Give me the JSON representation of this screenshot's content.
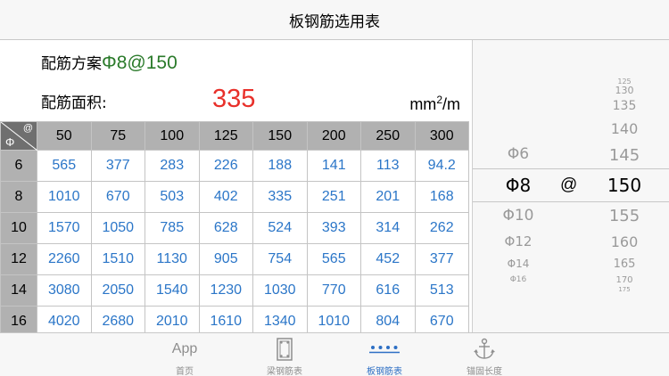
{
  "nav": {
    "title": "板钢筋选用表"
  },
  "scheme": {
    "label": "配筋方案",
    "value": "Φ8@150"
  },
  "area": {
    "label": "配筋面积:",
    "value": "335",
    "unit_base": "mm",
    "unit_exp": "2",
    "unit_tail": "/m"
  },
  "table": {
    "corner_at": "@",
    "corner_phi": "Φ",
    "spacings": [
      "50",
      "75",
      "100",
      "125",
      "150",
      "200",
      "250",
      "300"
    ],
    "rows": [
      {
        "dia": "6",
        "values": [
          "565",
          "377",
          "283",
          "226",
          "188",
          "141",
          "113",
          "94.2"
        ]
      },
      {
        "dia": "8",
        "values": [
          "1010",
          "670",
          "503",
          "402",
          "335",
          "251",
          "201",
          "168"
        ]
      },
      {
        "dia": "10",
        "values": [
          "1570",
          "1050",
          "785",
          "628",
          "524",
          "393",
          "314",
          "262"
        ]
      },
      {
        "dia": "12",
        "values": [
          "2260",
          "1510",
          "1130",
          "905",
          "754",
          "565",
          "452",
          "377"
        ]
      },
      {
        "dia": "14",
        "values": [
          "3080",
          "2050",
          "1540",
          "1230",
          "1030",
          "770",
          "616",
          "513"
        ]
      },
      {
        "dia": "16",
        "values": [
          "4020",
          "2680",
          "2010",
          "1610",
          "1340",
          "1010",
          "804",
          "670"
        ]
      }
    ]
  },
  "picker": {
    "at": "@",
    "diameters": [
      "Φ6",
      "Φ8",
      "Φ10",
      "Φ12",
      "Φ14",
      "Φ16"
    ],
    "spacings": [
      "125",
      "130",
      "135",
      "140",
      "145",
      "150",
      "155",
      "160",
      "165",
      "170",
      "175"
    ],
    "selected_diameter": "Φ8",
    "selected_spacing": "150"
  },
  "tabs": [
    {
      "label": "首页",
      "icon": "app-text-icon",
      "icon_text": "App"
    },
    {
      "label": "梁钢筋表",
      "icon": "beam-section-icon"
    },
    {
      "label": "板钢筋表",
      "icon": "slab-dots-icon"
    },
    {
      "label": "锚固长度",
      "icon": "anchor-icon"
    }
  ],
  "colors": {
    "accent": "#2d6fc4",
    "value_blue": "#2b76c8",
    "area_red": "#e8302a",
    "scheme_green": "#2a7a2a"
  }
}
